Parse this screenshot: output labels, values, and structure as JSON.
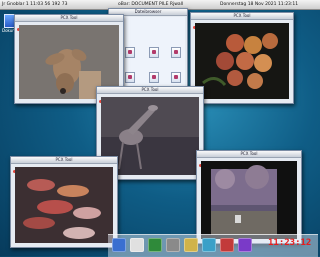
{
  "menubar": {
    "left": "Jr  Gnoblar  1 11:03 56 192 73",
    "mid": "oBar: DOCUMENT PILE Rjwall",
    "right": "Donnerstag 18 Nov 2021 11:23:11"
  },
  "desktop": {
    "icon_label": "Dokumente"
  },
  "windows": [
    {
      "title": "PCX Tool",
      "subject": "deer"
    },
    {
      "title": "Dateibrowser",
      "subject": "file-browser"
    },
    {
      "title": "PCX Tool",
      "subject": "apples"
    },
    {
      "title": "PCX Tool",
      "subject": "giraffe"
    },
    {
      "title": "PCX Tool",
      "subject": "koi-fish"
    },
    {
      "title": "PCX Tool",
      "subject": "garden"
    }
  ],
  "dock": {
    "clock": "11:23:12",
    "colors": [
      "#3a6fd0",
      "#e0e0e0",
      "#2f8a3a",
      "#8a8a8a",
      "#d0b34a",
      "#3aa0c8",
      "#c23a3a",
      "#7a3ac8"
    ]
  }
}
